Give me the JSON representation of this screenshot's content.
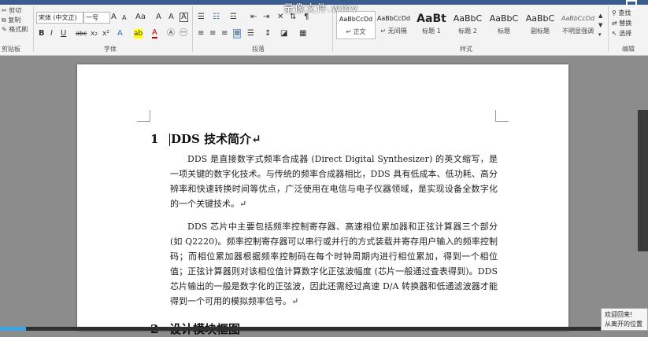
{
  "video_overlay": {
    "filename": "录像文件.wmv",
    "progress": 0.04
  },
  "ribbon": {
    "clipboard": {
      "cut": "剪切",
      "copy": "复制",
      "format_painter": "格式刷",
      "label": "剪贴板"
    },
    "font": {
      "name": "宋体 (中文正)",
      "size": "一号",
      "bold": "B",
      "italic": "I",
      "underline": "U",
      "strike": "abc",
      "subscript": "x₂",
      "superscript": "x²",
      "grow": "A",
      "shrink": "A",
      "change_case": "Aa",
      "clear": "A",
      "phonetic": "A",
      "border": "A",
      "effects": "A",
      "highlight": "ab",
      "color": "A",
      "label": "字体"
    },
    "paragraph": {
      "label": "段落"
    },
    "styles": {
      "label": "样式",
      "items": [
        {
          "sample": "AaBbCcDd",
          "name": "↵ 正文"
        },
        {
          "sample": "AaBbCcDd",
          "name": "↵ 无间隔"
        },
        {
          "sample": "AaBt",
          "name": "标题 1"
        },
        {
          "sample": "AaBbC",
          "name": "标题 2"
        },
        {
          "sample": "AaBbC",
          "name": "标题"
        },
        {
          "sample": "AaBbC",
          "name": "副标题"
        },
        {
          "sample": "AaBbCcDd",
          "name": "不明显强调"
        }
      ]
    },
    "editing": {
      "find": "查找",
      "replace": "替换",
      "select": "选择",
      "label": "编辑"
    }
  },
  "document": {
    "heading1": {
      "number": "1",
      "text": "DDS 技术简介↵"
    },
    "paragraphs": [
      "DDS 是直接数字式频率合成器 (Direct Digital Synthesizer) 的英文缩写，是一项关键的数字化技术。与传统的频率合成器相比，DDS 具有低成本、低功耗、高分辨率和快速转换时间等优点，广泛使用在电信与电子仪器领域，是实现设备全数字化的一个关键技术。↵",
      "DDS 芯片中主要包括频率控制寄存器、高速相位累加器和正弦计算器三个部分 (如 Q2220)。频率控制寄存器可以串行或并行的方式装载并寄存用户输入的频率控制码；而相位累加器根据频率控制码在每个时钟周期内进行相位累加，得到一个相位值；正弦计算器则对该相位值计算数字化正弦波幅度 (芯片一般通过查表得到)。DDS 芯片输出的一般是数字化的正弦波，因此还需经过高速 D/A 转换器和低通滤波器才能得到一个可用的模拟频率信号。↵"
    ],
    "heading2": {
      "number": "2",
      "text": "设计模块框图"
    }
  },
  "toast": {
    "line1": "欢迎回来!",
    "line2": "从离开的位置"
  }
}
